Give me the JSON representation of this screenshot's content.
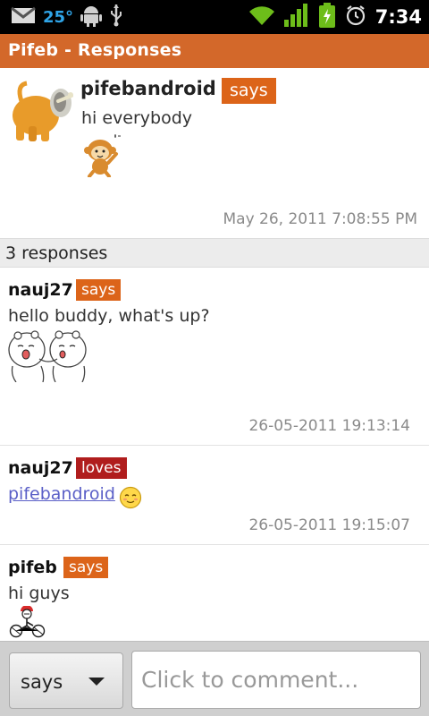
{
  "status_bar": {
    "temperature": "25°",
    "time": "7:34",
    "icons": [
      "gmail-icon",
      "android-icon",
      "usb-icon",
      "wifi-icon",
      "signal-icon",
      "battery-icon",
      "alarm-icon"
    ]
  },
  "app": {
    "title": "Pifeb - Responses"
  },
  "post": {
    "author": "pifebandroid",
    "verb": "says",
    "text": "hi everybody",
    "timestamp": "May 26, 2011 7:08:55 PM"
  },
  "responses_header": "3 responses",
  "responses": [
    {
      "author": "nauj27",
      "verb": "says",
      "text": "hello buddy, what's up?",
      "timestamp": "26-05-2011 19:13:14"
    },
    {
      "author": "nauj27",
      "verb": "loves",
      "link": "pifebandroid",
      "timestamp": "26-05-2011 19:15:07"
    },
    {
      "author": "pifeb",
      "verb": "says",
      "text": "hi guys"
    }
  ],
  "composer": {
    "verb_selected": "says",
    "placeholder": "Click to comment..."
  },
  "colors": {
    "accent": "#d3682a",
    "says": "#dc6419",
    "loves": "#b01d1d",
    "link": "#5a5fc7"
  }
}
